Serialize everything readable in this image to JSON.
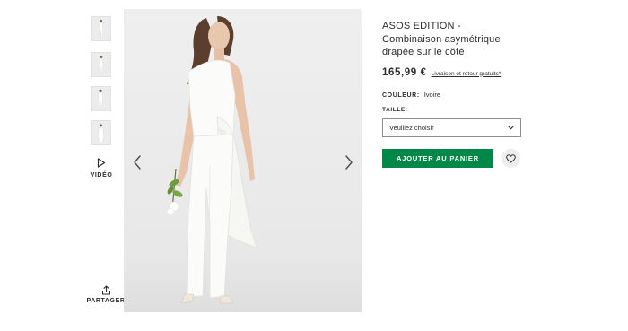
{
  "gallery": {
    "thumbnails": [
      {
        "icon": "model-full-body-thumbnail"
      },
      {
        "icon": "model-side-view-thumbnail"
      },
      {
        "icon": "model-back-view-thumbnail"
      },
      {
        "icon": "model-detail-thumbnail"
      }
    ],
    "video_label": "VIDÉO",
    "share_label": "PARTAGER",
    "prev_icon": "chevron-left-icon",
    "next_icon": "chevron-right-icon"
  },
  "product": {
    "title_line1": "ASOS EDITION -",
    "title_line2": "Combinaison asymétrique",
    "title_line3": "drapée sur le côté",
    "price": "165,99 €",
    "shipping_link": "Livraison et retour gratuits*",
    "color_label": "COULEUR:",
    "color_value": "Ivoire",
    "size_label": "TAILLE:",
    "size_placeholder": "Veuillez choisir",
    "add_to_bag_label": "AJOUTER AU PANIER",
    "save_icon": "heart-icon"
  },
  "colors": {
    "accent_green": "#018849",
    "text": "#2d2d2d",
    "image_background": "#ededed"
  }
}
